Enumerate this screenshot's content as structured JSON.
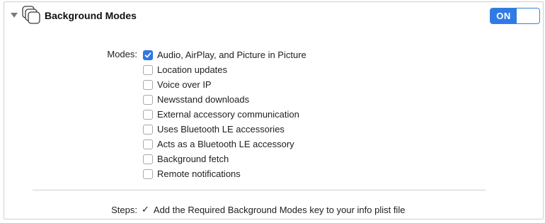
{
  "capability": {
    "title": "Background Modes",
    "icon": "background-modes-icon",
    "expanded": true,
    "toggle": {
      "label": "ON",
      "state": "on",
      "accent_color": "#2f7ae5"
    }
  },
  "modes": {
    "label": "Modes:",
    "items": [
      {
        "label": "Audio, AirPlay, and Picture in Picture",
        "checked": true
      },
      {
        "label": "Location updates",
        "checked": false
      },
      {
        "label": "Voice over IP",
        "checked": false
      },
      {
        "label": "Newsstand downloads",
        "checked": false
      },
      {
        "label": "External accessory communication",
        "checked": false
      },
      {
        "label": "Uses Bluetooth LE accessories",
        "checked": false
      },
      {
        "label": "Acts as a Bluetooth LE accessory",
        "checked": false
      },
      {
        "label": "Background fetch",
        "checked": false
      },
      {
        "label": "Remote notifications",
        "checked": false
      }
    ]
  },
  "steps": {
    "label": "Steps:",
    "items": [
      {
        "text": "Add the Required Background Modes key to your info plist file",
        "done": true,
        "check_glyph": "✓"
      }
    ]
  }
}
